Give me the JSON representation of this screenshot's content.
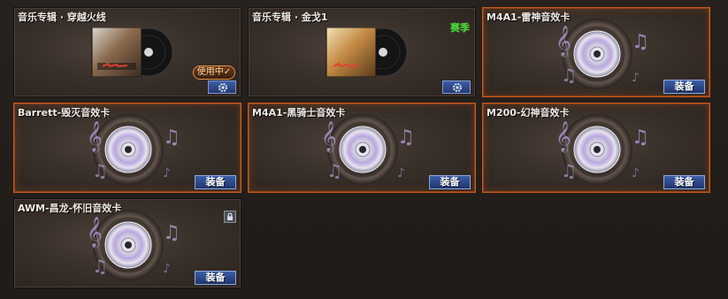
{
  "cards": [
    {
      "title": "音乐专辑 · 穿越火线",
      "type": "album",
      "in_use_label": "使用中✓",
      "has_settings": true
    },
    {
      "title": "音乐专辑 · 金戈1",
      "type": "album",
      "season_label": "赛季",
      "has_settings": true
    },
    {
      "title": "M4A1-雷神音效卡",
      "type": "sound",
      "button_label": "装备",
      "selected": true
    },
    {
      "title": "Barrett-毁灭音效卡",
      "type": "sound",
      "button_label": "装备",
      "selected": true
    },
    {
      "title": "M4A1-黑骑士音效卡",
      "type": "sound",
      "button_label": "装备",
      "selected": true
    },
    {
      "title": "M200-幻神音效卡",
      "type": "sound",
      "button_label": "装备",
      "selected": true
    },
    {
      "title": "AWM-昌龙-怀旧音效卡",
      "type": "sound",
      "button_label": "装备",
      "locked": true
    }
  ],
  "colors": {
    "season": "#4cdc3c",
    "selected_border": "#c85a1e",
    "button": "#2e4a8e"
  },
  "icons": [
    "gear-icon",
    "lock-icon",
    "music-disc-icon",
    "music-note-icon"
  ]
}
